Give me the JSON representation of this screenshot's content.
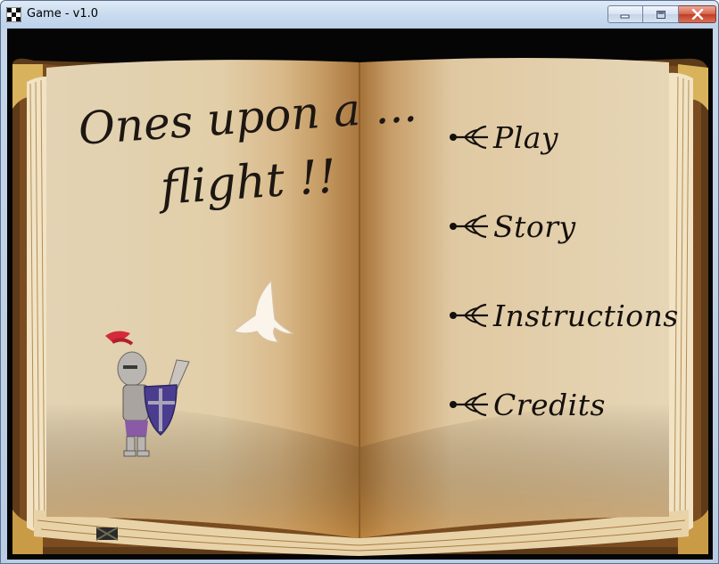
{
  "window": {
    "title": "Game - v1.0",
    "controls": [
      "minimize",
      "maximize",
      "close"
    ]
  },
  "book": {
    "title_line1": "Ones upon a ...",
    "title_line2": "flight !!"
  },
  "menu": {
    "items": [
      {
        "label": "Play",
        "icon": "fleur-arrow-icon"
      },
      {
        "label": "Story",
        "icon": "fleur-arrow-icon"
      },
      {
        "label": "Instructions",
        "icon": "fleur-arrow-icon"
      },
      {
        "label": "Credits",
        "icon": "fleur-arrow-icon"
      }
    ]
  },
  "colors": {
    "page": "#e6d4b0",
    "page_shadow": "#b98e55",
    "cover": "#5a3716",
    "ink": "#14100c",
    "background": "#050505"
  }
}
